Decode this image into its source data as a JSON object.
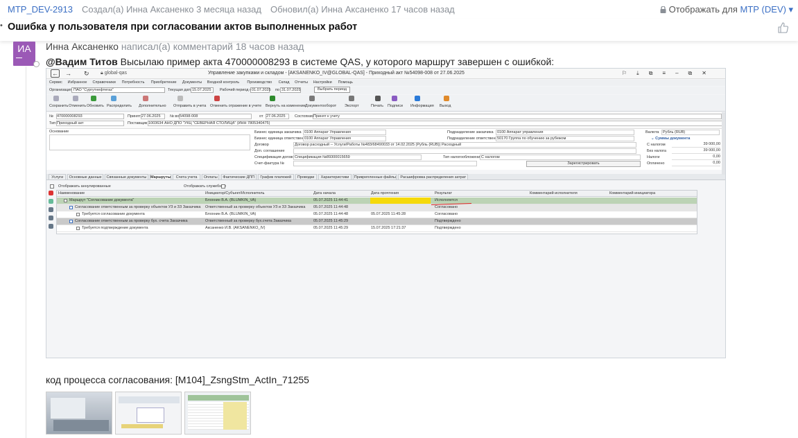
{
  "header": {
    "key": "MTP_DEV-2913",
    "created": "Создал(а) Инна Аксаненко 3 месяца назад",
    "updated": "Обновил(а) Инна Аксаненко 17 часов назад",
    "visibility_prefix": "Отображать для",
    "visibility_value": "МТР (DEV) ▾"
  },
  "issue": {
    "title": "Ошибка у пользователя при согласовании актов выполненных работ"
  },
  "comment": {
    "avatar_initials": "ИА",
    "author": "Инна Аксаненко",
    "action": "написал(а) комментарий 18 часов назад",
    "mention": "@Вадим Титов",
    "text": "Высылаю пример акта 470000008293 в системе QAS, у которого маршрут завершен с ошибкой:",
    "process_code_text": "код процесса согласования: [M104]_ZsngStm_ActIn_71255"
  },
  "screenshot": {
    "url": "global-qas",
    "window_title": "Управление закупками и складом - [AKSANENKO_IV@GLOBAL-QAS] - Приходный акт №54098-008 от 27.06.2025",
    "menu": [
      "Сервис",
      "Избранное",
      "Справочники",
      "Потребность",
      "Приобретение",
      "Документы",
      "Входной контроль",
      "Производство",
      "Склад",
      "Отчеты",
      "Настройки",
      "Помощь"
    ],
    "org_label": "Организация:",
    "org_value": "ПАО \"Сургутнефтегаз\"",
    "date_label": "Текущая дата",
    "date_value": "15.07.2025",
    "period_label": "Рабочий период с",
    "period_from": "01.07.2025",
    "period_to_label": "по",
    "period_to": "31.07.2025",
    "period_btn": "Выбрать период",
    "tools": [
      "Сохранить",
      "Отменить",
      "Обновить",
      "Распределить",
      "Дополнительно",
      "Отправить в учета",
      "Отменить отражение в учете",
      "Вернуть на изменение",
      "Документооборот",
      "Экспорт",
      "Печать",
      "Подписи",
      "Информация",
      "Выход"
    ],
    "f_no_label": "№",
    "f_no": "470000008293",
    "f_recv_label": "Принят",
    "f_recv": "27.06.2025",
    "f_in_label": "№ вх.",
    "f_in": "54098-008",
    "f_from_label": "от",
    "f_from": "27.06.2025",
    "f_state_label": "Состояние",
    "f_state": "Принят к учету",
    "f_type_label": "Тип",
    "f_type": "Приходный акт",
    "f_supplier_label": "Поставщик",
    "f_supplier": "1003634 АНО ДПО \"УКЦ \"СЕВЕРНАЯ СТОЛИЦА\" (ИНН 7805340475)",
    "f_basis": "Основание",
    "f_be1_label": "Бизнес единица заказчика",
    "f_be1": "0100  Аппарат Управления",
    "f_be2_label": "Бизнес единица ответственного",
    "f_be2": "0100  Аппарат Управления",
    "f_contract_label": "Договор",
    "f_contract": "Договор расходный -- Услуги/Работы №483/68490033 от 14.02.2025 (Рубль (RUB)) Расходный",
    "f_addl_label": "Доп. соглашение",
    "f_spec_label": "Спецификация договора",
    "f_spec": "Спецификация №89300015659",
    "f_sf_label": "Счет-фактура №",
    "f_sub1_label": "Подразделение заказчика",
    "f_sub1": "0100  Аппарат управления",
    "f_sub2_label": "Подразделение ответственного",
    "f_sub2": "50170  Группа по обучению за рубежом",
    "f_tax_label": "Тип налогообложения",
    "f_tax": "С налогом",
    "f_reg_btn": "Зарегистрировать",
    "f_cur_label": "Валюта",
    "f_cur": "Рубль (RUB)",
    "f_sums": "Суммы документа",
    "f_with_tax_label": "С налогом",
    "f_with_tax": "39 000,00",
    "f_no_tax_label": "Без налога",
    "f_no_tax": "39 000,00",
    "f_taxes_label": "Налоги",
    "f_taxes": "0,00",
    "f_paid_label": "Оплачено",
    "f_paid": "0,00",
    "tabs": [
      "Услуги",
      "Основные данные",
      "Связанные документы",
      "Маршруты",
      "Счета учета",
      "Оплаты",
      "Фактические ДПП",
      "График платежей",
      "Проводки",
      "Характеристики",
      "Прикрепленные файлы",
      "Расшифровка распределения затрат"
    ],
    "chk1": "Отображать аннулированные",
    "chk2": "Отображать служебные",
    "columns": [
      "Наименование",
      "Инициатор/Субъект/Исполнитель",
      "Дата начала",
      "Дата прочтения",
      "Результат",
      "Комментарий исполнителя",
      "Комментарий инициатора"
    ],
    "rows": [
      {
        "name": "Маршрут \"Согласование документа\"",
        "who": "Блохнин В.А. (BLUMKIN_VA)",
        "start": "05.07.2025 11:44:41",
        "read": "",
        "result": "Исполняется"
      },
      {
        "name": "Согласование ответственным за проверку объектов УЗ и ЗЗ Заказчика",
        "who": "Ответственный за проверку объектов УЗ и ЗЗ Заказчика",
        "start": "05.07.2025 11:44:48",
        "read": "",
        "result": "Согласовано"
      },
      {
        "name": "Требуется согласование документа",
        "who": "Блохнин В.А. (BLUMKIN_VA)",
        "start": "05.07.2025 11:44:48",
        "read": "05.07.2025 11:45:28",
        "result": "Согласовано"
      },
      {
        "name": "Согласование ответственным за проверку бух. счета Заказчика",
        "who": "Ответственный за проверку бух.счета Заказчика",
        "start": "05.07.2025 11:45:29",
        "read": "",
        "result": "Подтверждено"
      },
      {
        "name": "Требуется подтверждение документа",
        "who": "Аксаненко И.В. (AKSANENKO_IV)",
        "start": "05.07.2025 11:45:29",
        "read": "15.07.2025 17:21:37",
        "result": "Подтверждено"
      }
    ]
  },
  "colors": {
    "accent": "#3b6fc4",
    "avatar": "#9b59b6",
    "highlight": "#f5d90a",
    "row_selected": "#bcd3b5",
    "row_group": "#c9c9c9"
  }
}
